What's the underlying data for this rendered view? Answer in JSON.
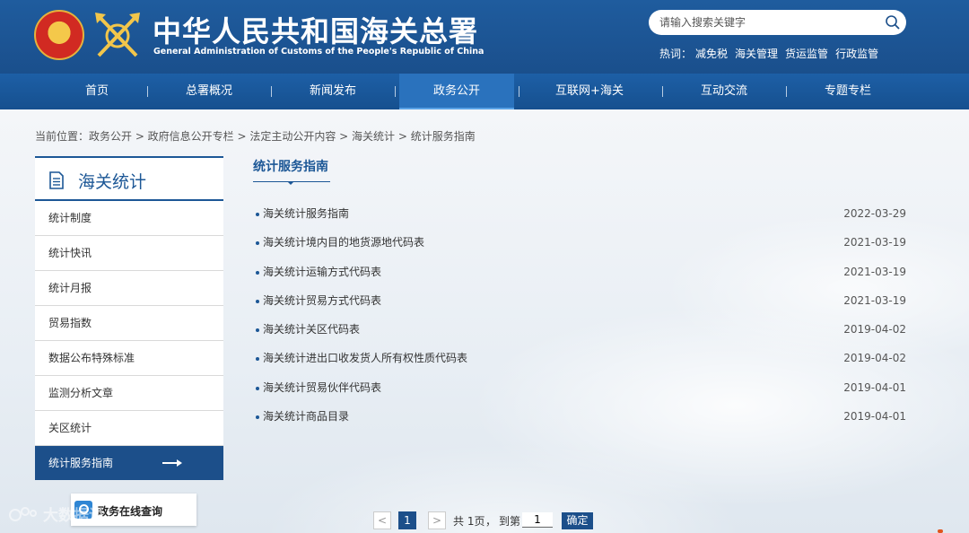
{
  "header": {
    "title": "中华人民共和国海关总署",
    "subtitle": "General Administration of Customs of the People's Republic of China",
    "search_placeholder": "请输入搜索关键字",
    "hot_label": "热词：",
    "hot_words": [
      "减免税",
      "海关管理",
      "货运监管",
      "行政监管"
    ]
  },
  "nav": {
    "items": [
      "首页",
      "总署概况",
      "新闻发布",
      "政务公开",
      "互联网+海关",
      "互动交流",
      "专题专栏"
    ],
    "active": "政务公开"
  },
  "breadcrumb": "当前位置：政务公开 > 政府信息公开专栏 > 法定主动公开内容 > 海关统计 > 统计服务指南",
  "sidebar": {
    "title": "海关统计",
    "items": [
      "统计制度",
      "统计快讯",
      "统计月报",
      "贸易指数",
      "数据公布特殊标准",
      "监测分析文章",
      "关区统计",
      "统计服务指南"
    ],
    "active": "统计服务指南"
  },
  "section": {
    "title": "统计服务指南"
  },
  "list": [
    {
      "title": "海关统计服务指南",
      "date": "2022-03-29"
    },
    {
      "title": "海关统计境内目的地货源地代码表",
      "date": "2021-03-19"
    },
    {
      "title": "海关统计运输方式代码表",
      "date": "2021-03-19"
    },
    {
      "title": "海关统计贸易方式代码表",
      "date": "2021-03-19"
    },
    {
      "title": "海关统计关区代码表",
      "date": "2019-04-02"
    },
    {
      "title": "海关统计进出口收发货人所有权性质代码表",
      "date": "2019-04-02"
    },
    {
      "title": "海关统计贸易伙伴代码表",
      "date": "2019-04-01"
    },
    {
      "title": "海关统计商品目录",
      "date": "2019-04-01"
    }
  ],
  "pagination": {
    "prev": "<",
    "current_page": "1",
    "next": ">",
    "total_text": "共 1页",
    "comma": "，",
    "goto_label": "到第",
    "goto_value": "1",
    "confirm_label": "确定"
  },
  "online_query": {
    "label": "政务在线查询"
  },
  "watermark_text": "大数据说"
}
